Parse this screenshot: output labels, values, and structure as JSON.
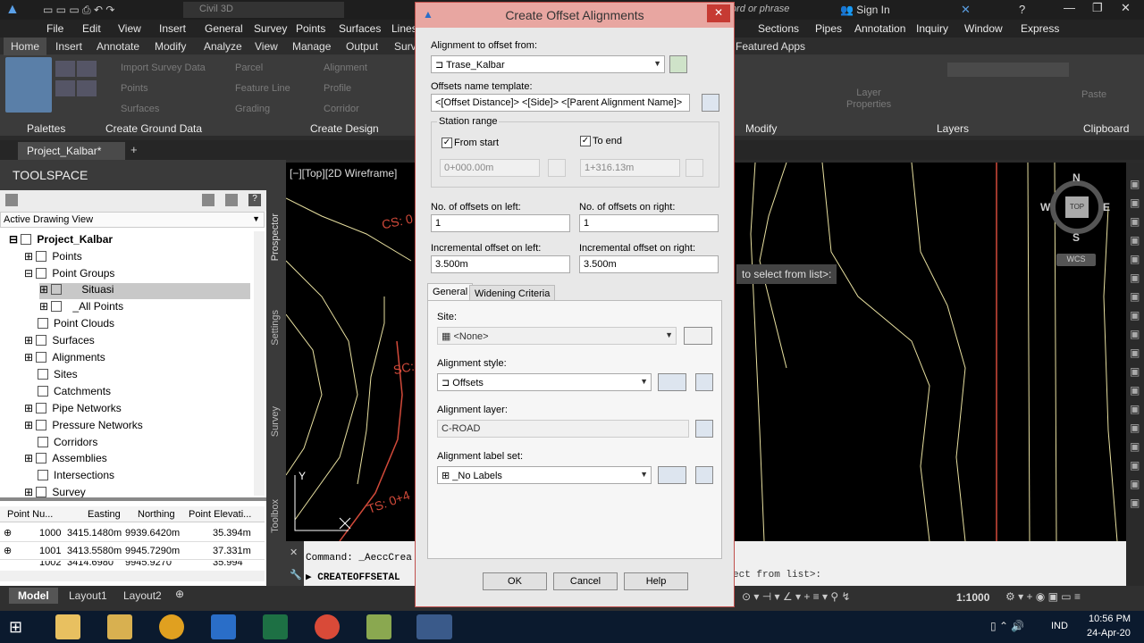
{
  "app": {
    "title": "Civil 3D",
    "search_placeholder": "ord or phrase",
    "sign_in": "Sign In"
  },
  "menubar": [
    "File",
    "Edit",
    "View",
    "Insert",
    "General",
    "Survey",
    "Points",
    "Surfaces",
    "Lines",
    "Sections",
    "Pipes",
    "Annotation",
    "Inquiry",
    "Window",
    "Express"
  ],
  "ribbon_tabs": [
    "Home",
    "Insert",
    "Annotate",
    "Modify",
    "Analyze",
    "View",
    "Manage",
    "Output",
    "Surv",
    "Featured Apps"
  ],
  "ribbon": {
    "items": [
      "Import Survey Data",
      "Points",
      "Surfaces",
      "Parcel",
      "Feature Line",
      "Grading",
      "Alignment",
      "Profile",
      "Corridor",
      "Layer Properties",
      "Paste"
    ],
    "panels": [
      "Palettes",
      "Create Ground Data",
      "Create Design",
      "Modify",
      "Layers",
      "Clipboard"
    ]
  },
  "file_tabs": {
    "active": "Project_Kalbar*",
    "add": "+"
  },
  "toolspace": {
    "title": "TOOLSPACE",
    "view": "Active Drawing View",
    "side_tabs": [
      "Prospector",
      "Settings",
      "Survey",
      "Toolbox"
    ],
    "tree": [
      "Project_Kalbar",
      "Points",
      "Point Groups",
      "Situasi",
      "_All Points",
      "Point Clouds",
      "Surfaces",
      "Alignments",
      "Sites",
      "Catchments",
      "Pipe Networks",
      "Pressure Networks",
      "Corridors",
      "Assemblies",
      "Intersections",
      "Survey"
    ],
    "table_headers": [
      "Point Nu...",
      "Easting",
      "Northing",
      "Point Elevati..."
    ],
    "table_rows": [
      [
        "1000",
        "3415.1480m",
        "9939.6420m",
        "35.394m"
      ],
      [
        "1001",
        "3413.5580m",
        "9945.7290m",
        "37.331m"
      ],
      [
        "1002",
        "3414.6980",
        "9945.9270",
        "35.994"
      ]
    ]
  },
  "viewport": {
    "label": "[−][Top][2D Wireframe]",
    "compass": {
      "n": "N",
      "s": "S",
      "e": "E",
      "w": "W",
      "top": "TOP",
      "wcs": "WCS"
    },
    "prompt": "to select from list>:",
    "annotations": [
      "CS: 0",
      "SC:",
      "TS: 0+4"
    ],
    "axis_y": "Y"
  },
  "command": {
    "line1": "Command: _AeccCrea",
    "line2": "CREATEOFFSETAL",
    "tail": "ect from list>:"
  },
  "layout_tabs": [
    "Model",
    "Layout1",
    "Layout2"
  ],
  "status": {
    "scale": "1:1000"
  },
  "taskbar": {
    "lang": "IND",
    "time": "10:56 PM",
    "date": "24-Apr-20"
  },
  "dialog": {
    "title": "Create Offset Alignments",
    "alignment_label": "Alignment to offset from:",
    "alignment_value": "Trase_Kalbar",
    "template_label": "Offsets name template:",
    "template_value": "<[Offset Distance]> <[Side]> <[Parent Alignment Name]>",
    "station_range": "Station range",
    "from_start": "From start",
    "to_end": "To end",
    "start_value": "0+000.00m",
    "end_value": "1+316.13m",
    "left_count_label": "No. of offsets on left:",
    "left_count": "1",
    "right_count_label": "No. of offsets on right:",
    "right_count": "1",
    "inc_left_label": "Incremental offset on left:",
    "inc_left": "3.500m",
    "inc_right_label": "Incremental offset on right:",
    "inc_right": "3.500m",
    "tabs": [
      "General",
      "Widening Criteria"
    ],
    "site_label": "Site:",
    "site_value": "<None>",
    "style_label": "Alignment style:",
    "style_value": "Offsets",
    "layer_label": "Alignment layer:",
    "layer_value": "C-ROAD",
    "labelset_label": "Alignment label set:",
    "labelset_value": "_No Labels",
    "ok": "OK",
    "cancel": "Cancel",
    "help": "Help"
  }
}
